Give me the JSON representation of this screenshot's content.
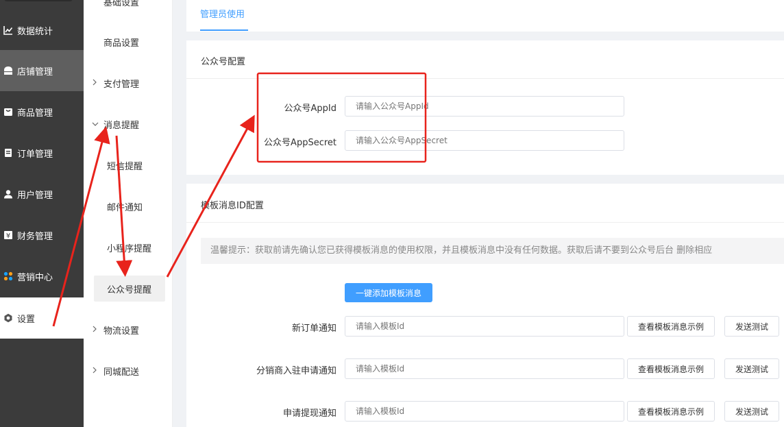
{
  "sidebar": {
    "items": [
      {
        "label": "数据统计",
        "icon": "chart-icon"
      },
      {
        "label": "店铺管理",
        "icon": "store-icon"
      },
      {
        "label": "商品管理",
        "icon": "goods-icon"
      },
      {
        "label": "订单管理",
        "icon": "order-icon"
      },
      {
        "label": "用户管理",
        "icon": "user-icon"
      },
      {
        "label": "财务管理",
        "icon": "finance-icon"
      },
      {
        "label": "营销中心",
        "icon": "marketing-icon"
      },
      {
        "label": "设置",
        "icon": "settings-icon"
      }
    ]
  },
  "submenu": {
    "partial_top": "基础设置",
    "items": [
      {
        "label": "商品设置"
      },
      {
        "label": "支付管理"
      },
      {
        "label": "消息提醒"
      },
      {
        "label": "物流设置"
      },
      {
        "label": "同城配送"
      }
    ],
    "children": [
      {
        "label": "短信提醒"
      },
      {
        "label": "邮件通知"
      },
      {
        "label": "小程序提醒"
      },
      {
        "label": "公众号提醒"
      }
    ]
  },
  "tabs": {
    "admin_use": "管理员使用"
  },
  "official_account": {
    "title": "公众号配置",
    "appid_label": "公众号AppId",
    "appid_placeholder": "请输入公众号AppId",
    "secret_label": "公众号AppSecret",
    "secret_placeholder": "请输入公众号AppSecret"
  },
  "template": {
    "title": "模板消息ID配置",
    "tip": "温馨提示：获取前请先确认您已获得模板消息的使用权限，并且模板消息中没有任何数据。获取后请不要到公众号后台 删除相应",
    "add_button": "一键添加模板消息",
    "view_example": "查看模板消息示例",
    "send_test": "发送测试",
    "placeholder": "请输入模板Id",
    "rows": [
      {
        "label": "新订单通知"
      },
      {
        "label": "分销商入驻申请通知"
      },
      {
        "label": "申请提现通知"
      }
    ]
  },
  "colors": {
    "accent": "#409eff",
    "annotation": "#e8231c",
    "sidebar": "#3b3b3b"
  }
}
